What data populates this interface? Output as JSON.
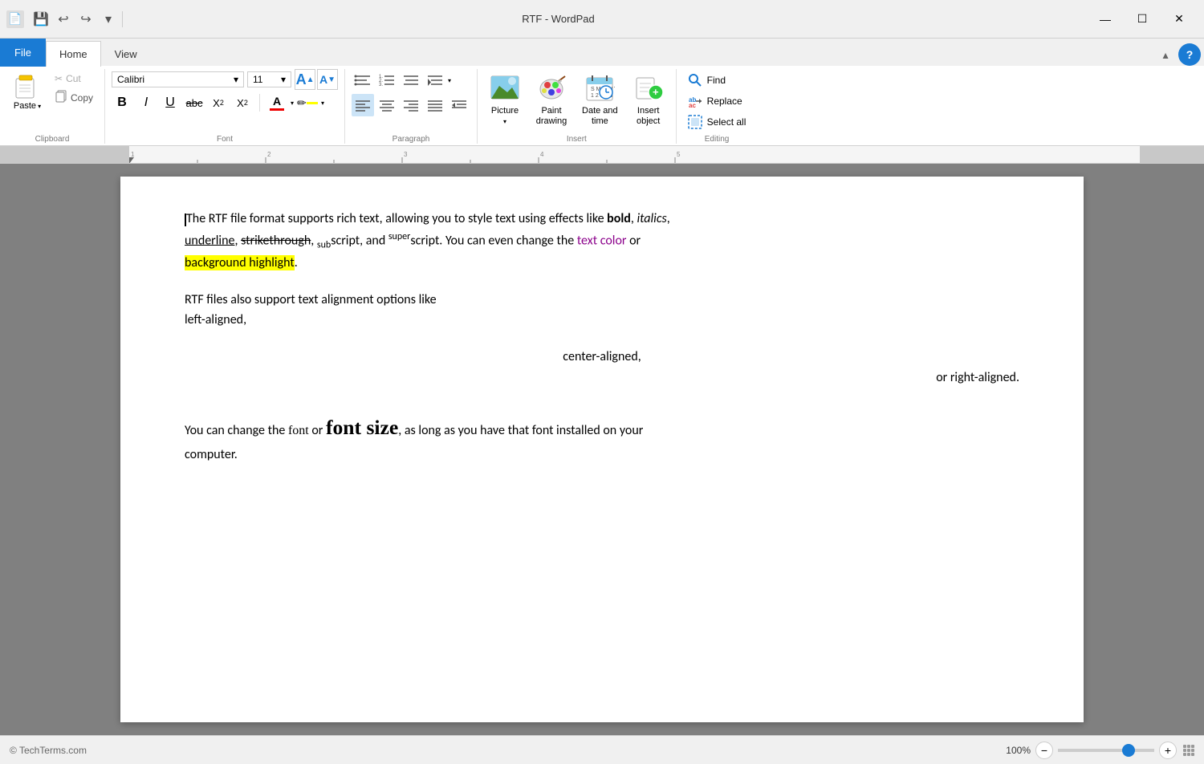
{
  "window": {
    "title": "RTF - WordPad",
    "controls": {
      "minimize": "—",
      "maximize": "☐",
      "close": "✕"
    }
  },
  "titlebar": {
    "qs_buttons": [
      "💾",
      "↩",
      "↪"
    ],
    "custom_btn": "▾"
  },
  "tabs": {
    "file": "File",
    "home": "Home",
    "view": "View"
  },
  "ribbon": {
    "clipboard": {
      "label": "Clipboard",
      "paste_label": "Paste",
      "paste_arrow": "▾",
      "cut_label": "Cut",
      "copy_label": "Copy"
    },
    "font": {
      "label": "Font",
      "font_name": "Calibri",
      "font_size": "11",
      "grow_btn": "A",
      "shrink_btn": "A",
      "bold": "B",
      "italic": "I",
      "underline": "U",
      "strikethrough": "abc",
      "subscript": "X₂",
      "superscript": "X²",
      "font_color": "A",
      "highlight_color": "✏"
    },
    "paragraph": {
      "label": "Paragraph"
    },
    "insert": {
      "label": "Insert",
      "picture_label": "Picture",
      "paint_label": "Paint\ndrawing",
      "datetime_label": "Date and\ntime",
      "object_label": "Insert\nobject"
    },
    "editing": {
      "label": "Editing",
      "find_label": "Find",
      "replace_label": "Replace",
      "select_all_label": "Select all"
    }
  },
  "document": {
    "para1_before": "The RTF file format supports rich text, allowing you to style text using effects like ",
    "bold_text": "bold",
    "comma1": ", ",
    "italic_text": "italics",
    "comma2": ",",
    "nl1": "",
    "underline_text": "underline",
    "comma3": ", ",
    "strike_text": "strikethrough",
    "comma4": ", ",
    "sub_text": "sub",
    "script1": "script, and ",
    "super_text": "super",
    "script2": "script. You can even change the ",
    "color_text": "text color",
    "para1_after": " or",
    "highlight_text": "background highlight",
    "period1": ".",
    "para2_line1": "RTF files also support text alignment options like",
    "para2_line2": "left-aligned,",
    "para2_center": "center-aligned,",
    "para2_right": "or right-aligned.",
    "para3_before": "You can change the ",
    "font1": "font",
    "or_text": " or ",
    "font2": "font size",
    "para3_after": ", as long as you have that font installed on your",
    "para3_last": "computer."
  },
  "status": {
    "copyright": "© TechTerms.com",
    "zoom": "100%"
  }
}
